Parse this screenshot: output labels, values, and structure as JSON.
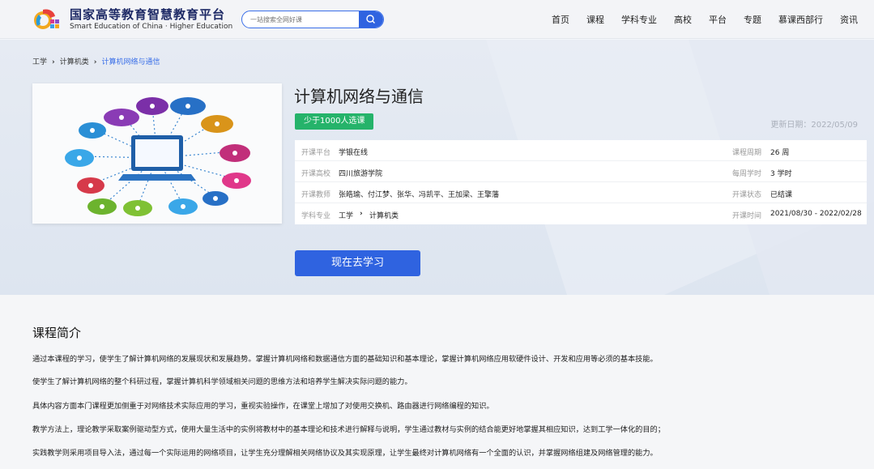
{
  "header": {
    "brand_cn": "国家高等教育智慧教育平台",
    "brand_en": "Smart Education of China · Higher Education",
    "search_placeholder": "一站搜索全网好课",
    "nav": [
      "首页",
      "课程",
      "学科专业",
      "高校",
      "平台",
      "专题",
      "慕课西部行",
      "资讯"
    ]
  },
  "breadcrumb": [
    "工学",
    "计算机类",
    "计算机网络与通信"
  ],
  "course": {
    "title": "计算机网络与通信",
    "enroll_badge": "少于1000人选课",
    "update_date": "更新日期：2022/05/09",
    "info": {
      "platform_label": "开课平台",
      "platform": "学银在线",
      "school_label": "开课高校",
      "school": "四川旅游学院",
      "teachers_label": "开课教师",
      "teachers": "张皓瑜、付江梦、张华、冯凯平、王加梁、王擎藩",
      "subject_label": "学科专业",
      "subject_1": "工学",
      "subject_2": "计算机类",
      "period_label": "课程周期",
      "period": "26 周",
      "hours_label": "每周学时",
      "hours": "3 学时",
      "status_label": "开课状态",
      "status": "已结课",
      "time_label": "开课时间",
      "time": "2021/08/30 - 2022/02/28"
    },
    "study_button": "现在去学习"
  },
  "intro": {
    "heading": "课程简介",
    "paragraphs": [
      "通过本课程的学习，使学生了解计算机网络的发展现状和发展趋势。掌握计算机网络和数据通信方面的基础知识和基本理论，掌握计算机网络应用软硬件设计、开发和应用等必须的基本技能。",
      "使学生了解计算机网络的整个科研过程，掌握计算机科学领域相关问题的思维方法和培养学生解决实际问题的能力。",
      "具体内容方面本门课程更加侧重于对网络技术实际应用的学习，重视实验操作，在课堂上增加了对使用交换机、路由器进行网络编程的知识。",
      "教学方法上，理论教学采取案例驱动型方式，使用大量生活中的实例将教材中的基本理论和技术进行解释与说明，学生通过教材与实例的结合能更好地掌握其相应知识，达到工学一体化的目的；",
      "实践教学则采用项目导入法，通过每一个实际运用的网络项目，让学生充分理解相关网络协议及其实现原理，让学生最终对计算机网络有一个全面的认识，并掌握网络组建及网络管理的能力。"
    ]
  },
  "colors": {
    "accent": "#2f63e0",
    "badge": "#25b36a"
  }
}
